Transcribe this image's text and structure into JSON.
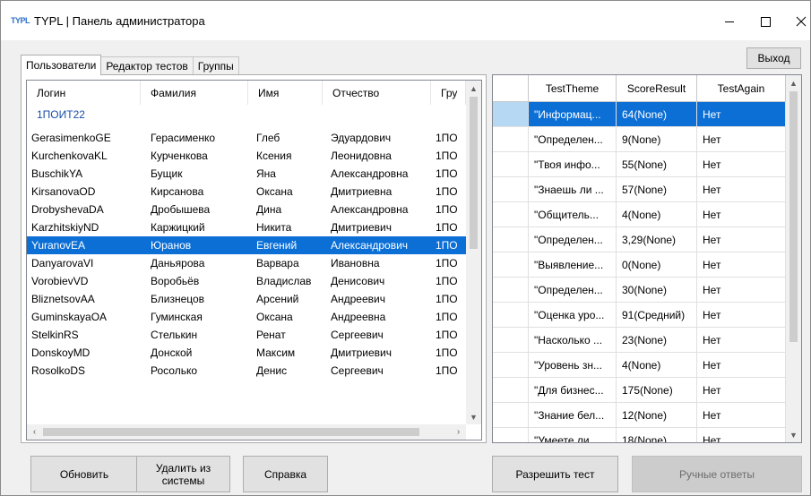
{
  "window": {
    "logo": "TYPL",
    "title": "TYPL | Панель администратора",
    "exit_label": "Выход"
  },
  "tabs": [
    {
      "label": "Пользователи",
      "active": true
    },
    {
      "label": "Редактор тестов",
      "active": false
    },
    {
      "label": "Группы",
      "active": false
    }
  ],
  "users": {
    "columns": [
      "Логин",
      "Фамилия",
      "Имя",
      "Отчество",
      "Гру"
    ],
    "group": "1ПОИТ22",
    "rows": [
      [
        "GerasimenkoGE",
        "Герасименко",
        "Глеб",
        "Эдуардович",
        "1ПО"
      ],
      [
        "KurchenkovaKL",
        "Курченкова",
        "Ксения",
        "Леонидовна",
        "1ПО"
      ],
      [
        "BuschikYA",
        "Бущик",
        "Яна",
        "Александровна",
        "1ПО"
      ],
      [
        "KirsanovaOD",
        "Кирсанова",
        "Оксана",
        "Дмитриевна",
        "1ПО"
      ],
      [
        "DrobyshevaDA",
        "Дробышева",
        "Дина",
        "Александровна",
        "1ПО"
      ],
      [
        "KarzhitskiyND",
        "Каржицкий",
        "Никита",
        "Дмитриевич",
        "1ПО"
      ],
      [
        "YuranovEA",
        "Юранов",
        "Евгений",
        "Александрович",
        "1ПО"
      ],
      [
        "DanyarovaVI",
        "Даньярова",
        "Варвара",
        "Ивановна",
        "1ПО"
      ],
      [
        "VorobievVD",
        "Воробьёв",
        "Владислав",
        "Денисович",
        "1ПО"
      ],
      [
        "BliznetsovAA",
        "Близнецов",
        "Арсений",
        "Андреевич",
        "1ПО"
      ],
      [
        "GuminskayaOA",
        "Гуминская",
        "Оксана",
        "Андреевна",
        "1ПО"
      ],
      [
        "StelkinRS",
        "Стелькин",
        "Ренат",
        "Сергеевич",
        "1ПО"
      ],
      [
        "DonskoyMD",
        "Донской",
        "Максим",
        "Дмитриевич",
        "1ПО"
      ],
      [
        "RosolkoDS",
        "Росолько",
        "Денис",
        "Сергеевич",
        "1ПО"
      ]
    ],
    "selected_index": 6
  },
  "results": {
    "columns": [
      "",
      "TestTheme",
      "ScoreResult",
      "TestAgain"
    ],
    "rows": [
      [
        "\"Информац...",
        "64(None)",
        "Нет"
      ],
      [
        "\"Определен...",
        "9(None)",
        "Нет"
      ],
      [
        "\"Твоя инфо...",
        "55(None)",
        "Нет"
      ],
      [
        "\"Знаешь ли ...",
        "57(None)",
        "Нет"
      ],
      [
        "\"Общитель...",
        "4(None)",
        "Нет"
      ],
      [
        "\"Определен...",
        "3,29(None)",
        "Нет"
      ],
      [
        "\"Выявление...",
        "0(None)",
        "Нет"
      ],
      [
        "\"Определен...",
        "30(None)",
        "Нет"
      ],
      [
        "\"Оценка уро...",
        "91(Средний)",
        "Нет"
      ],
      [
        "\"Насколько ...",
        "23(None)",
        "Нет"
      ],
      [
        "\"Уровень зн...",
        "4(None)",
        "Нет"
      ],
      [
        "\"Для бизнес...",
        "175(None)",
        "Нет"
      ],
      [
        "\"Знание бел...",
        "12(None)",
        "Нет"
      ],
      [
        "\"Умеете ли ...",
        "18(None)",
        "Нет"
      ]
    ],
    "selected_index": 0
  },
  "buttons": {
    "refresh": "Обновить",
    "delete": "Удалить из системы",
    "help": "Справка",
    "allow_test": "Разрешить тест",
    "manual_answers": "Ручные ответы"
  }
}
